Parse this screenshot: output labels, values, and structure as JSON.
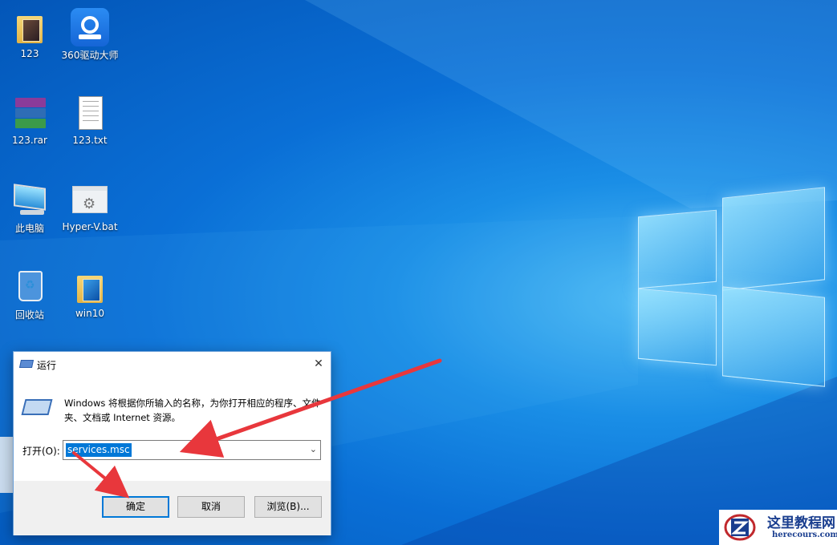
{
  "desktop": {
    "icons": [
      {
        "label": "123",
        "icon": "folder-icon"
      },
      {
        "label": "360驱动大师",
        "icon": "driver-master-icon"
      },
      {
        "label": "123.rar",
        "icon": "winrar-archive-icon"
      },
      {
        "label": "123.txt",
        "icon": "text-file-icon"
      },
      {
        "label": "此电脑",
        "icon": "this-pc-icon"
      },
      {
        "label": "Hyper-V.bat",
        "icon": "batch-file-icon"
      },
      {
        "label": "回收站",
        "icon": "recycle-bin-icon"
      },
      {
        "label": "win10",
        "icon": "folder-icon"
      }
    ]
  },
  "run_dialog": {
    "title": "运行",
    "close_glyph": "✕",
    "description": "Windows 将根据你所输入的名称，为你打开相应的程序、文件夹、文档或 Internet 资源。",
    "open_label": "打开(O):",
    "input_value": "services.msc",
    "dropdown_glyph": "⌄",
    "buttons": {
      "ok": "确定",
      "cancel": "取消",
      "browse": "浏览(B)..."
    }
  },
  "watermark": {
    "title": "这里教程网",
    "url": "herecours.com"
  },
  "colors": {
    "desktop_blue": "#0a6fd6",
    "accent": "#0078d7",
    "annotation_arrow": "#e8373c"
  }
}
